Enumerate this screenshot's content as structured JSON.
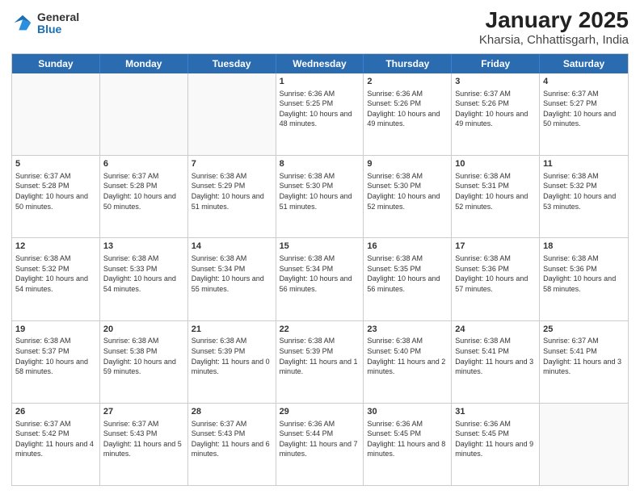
{
  "logo": {
    "general": "General",
    "blue": "Blue"
  },
  "title": "January 2025",
  "subtitle": "Kharsia, Chhattisgarh, India",
  "days": [
    "Sunday",
    "Monday",
    "Tuesday",
    "Wednesday",
    "Thursday",
    "Friday",
    "Saturday"
  ],
  "weeks": [
    [
      {
        "day": "",
        "empty": true
      },
      {
        "day": "",
        "empty": true
      },
      {
        "day": "",
        "empty": true
      },
      {
        "day": "1",
        "sunrise": "6:36 AM",
        "sunset": "5:25 PM",
        "daylight": "10 hours and 48 minutes."
      },
      {
        "day": "2",
        "sunrise": "6:36 AM",
        "sunset": "5:26 PM",
        "daylight": "10 hours and 49 minutes."
      },
      {
        "day": "3",
        "sunrise": "6:37 AM",
        "sunset": "5:26 PM",
        "daylight": "10 hours and 49 minutes."
      },
      {
        "day": "4",
        "sunrise": "6:37 AM",
        "sunset": "5:27 PM",
        "daylight": "10 hours and 50 minutes."
      }
    ],
    [
      {
        "day": "5",
        "sunrise": "6:37 AM",
        "sunset": "5:28 PM",
        "daylight": "10 hours and 50 minutes."
      },
      {
        "day": "6",
        "sunrise": "6:37 AM",
        "sunset": "5:28 PM",
        "daylight": "10 hours and 50 minutes."
      },
      {
        "day": "7",
        "sunrise": "6:38 AM",
        "sunset": "5:29 PM",
        "daylight": "10 hours and 51 minutes."
      },
      {
        "day": "8",
        "sunrise": "6:38 AM",
        "sunset": "5:30 PM",
        "daylight": "10 hours and 51 minutes."
      },
      {
        "day": "9",
        "sunrise": "6:38 AM",
        "sunset": "5:30 PM",
        "daylight": "10 hours and 52 minutes."
      },
      {
        "day": "10",
        "sunrise": "6:38 AM",
        "sunset": "5:31 PM",
        "daylight": "10 hours and 52 minutes."
      },
      {
        "day": "11",
        "sunrise": "6:38 AM",
        "sunset": "5:32 PM",
        "daylight": "10 hours and 53 minutes."
      }
    ],
    [
      {
        "day": "12",
        "sunrise": "6:38 AM",
        "sunset": "5:32 PM",
        "daylight": "10 hours and 54 minutes."
      },
      {
        "day": "13",
        "sunrise": "6:38 AM",
        "sunset": "5:33 PM",
        "daylight": "10 hours and 54 minutes."
      },
      {
        "day": "14",
        "sunrise": "6:38 AM",
        "sunset": "5:34 PM",
        "daylight": "10 hours and 55 minutes."
      },
      {
        "day": "15",
        "sunrise": "6:38 AM",
        "sunset": "5:34 PM",
        "daylight": "10 hours and 56 minutes."
      },
      {
        "day": "16",
        "sunrise": "6:38 AM",
        "sunset": "5:35 PM",
        "daylight": "10 hours and 56 minutes."
      },
      {
        "day": "17",
        "sunrise": "6:38 AM",
        "sunset": "5:36 PM",
        "daylight": "10 hours and 57 minutes."
      },
      {
        "day": "18",
        "sunrise": "6:38 AM",
        "sunset": "5:36 PM",
        "daylight": "10 hours and 58 minutes."
      }
    ],
    [
      {
        "day": "19",
        "sunrise": "6:38 AM",
        "sunset": "5:37 PM",
        "daylight": "10 hours and 58 minutes."
      },
      {
        "day": "20",
        "sunrise": "6:38 AM",
        "sunset": "5:38 PM",
        "daylight": "10 hours and 59 minutes."
      },
      {
        "day": "21",
        "sunrise": "6:38 AM",
        "sunset": "5:39 PM",
        "daylight": "11 hours and 0 minutes."
      },
      {
        "day": "22",
        "sunrise": "6:38 AM",
        "sunset": "5:39 PM",
        "daylight": "11 hours and 1 minute."
      },
      {
        "day": "23",
        "sunrise": "6:38 AM",
        "sunset": "5:40 PM",
        "daylight": "11 hours and 2 minutes."
      },
      {
        "day": "24",
        "sunrise": "6:38 AM",
        "sunset": "5:41 PM",
        "daylight": "11 hours and 3 minutes."
      },
      {
        "day": "25",
        "sunrise": "6:37 AM",
        "sunset": "5:41 PM",
        "daylight": "11 hours and 3 minutes."
      }
    ],
    [
      {
        "day": "26",
        "sunrise": "6:37 AM",
        "sunset": "5:42 PM",
        "daylight": "11 hours and 4 minutes."
      },
      {
        "day": "27",
        "sunrise": "6:37 AM",
        "sunset": "5:43 PM",
        "daylight": "11 hours and 5 minutes."
      },
      {
        "day": "28",
        "sunrise": "6:37 AM",
        "sunset": "5:43 PM",
        "daylight": "11 hours and 6 minutes."
      },
      {
        "day": "29",
        "sunrise": "6:36 AM",
        "sunset": "5:44 PM",
        "daylight": "11 hours and 7 minutes."
      },
      {
        "day": "30",
        "sunrise": "6:36 AM",
        "sunset": "5:45 PM",
        "daylight": "11 hours and 8 minutes."
      },
      {
        "day": "31",
        "sunrise": "6:36 AM",
        "sunset": "5:45 PM",
        "daylight": "11 hours and 9 minutes."
      },
      {
        "day": "",
        "empty": true
      }
    ]
  ],
  "labels": {
    "sunrise": "Sunrise:",
    "sunset": "Sunset:",
    "daylight": "Daylight:"
  }
}
